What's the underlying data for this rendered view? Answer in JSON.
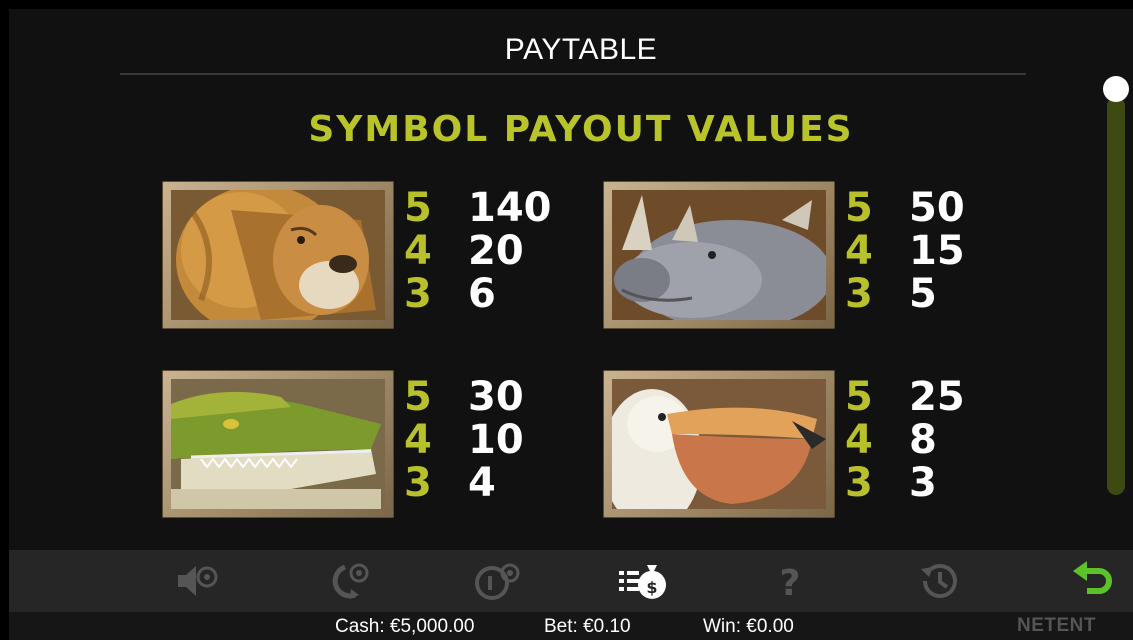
{
  "header": {
    "title": "PAYTABLE"
  },
  "section": {
    "title": "SYMBOL PAYOUT VALUES"
  },
  "symbols": [
    {
      "name": "lion",
      "pays": [
        {
          "count": "5",
          "value": "140"
        },
        {
          "count": "4",
          "value": "20"
        },
        {
          "count": "3",
          "value": "6"
        }
      ]
    },
    {
      "name": "rhino",
      "pays": [
        {
          "count": "5",
          "value": "50"
        },
        {
          "count": "4",
          "value": "15"
        },
        {
          "count": "3",
          "value": "5"
        }
      ]
    },
    {
      "name": "crocodile",
      "pays": [
        {
          "count": "5",
          "value": "30"
        },
        {
          "count": "4",
          "value": "10"
        },
        {
          "count": "3",
          "value": "4"
        }
      ]
    },
    {
      "name": "pelican",
      "pays": [
        {
          "count": "5",
          "value": "25"
        },
        {
          "count": "4",
          "value": "8"
        },
        {
          "count": "3",
          "value": "3"
        }
      ]
    }
  ],
  "toolbar": {
    "icons": [
      "sound-settings-icon",
      "autoplay-settings-icon",
      "coin-settings-icon",
      "paytable-icon",
      "help-icon",
      "history-icon",
      "back-icon"
    ],
    "active": "paytable-icon"
  },
  "status": {
    "cash": "Cash: €5,000.00",
    "bet": "Bet: €0.10",
    "win": "Win: €0.00",
    "brand": "NETENT"
  },
  "colors": {
    "accent": "#b9c42a",
    "back": "#5cc22a",
    "scrollbar": "#3d4a12"
  }
}
